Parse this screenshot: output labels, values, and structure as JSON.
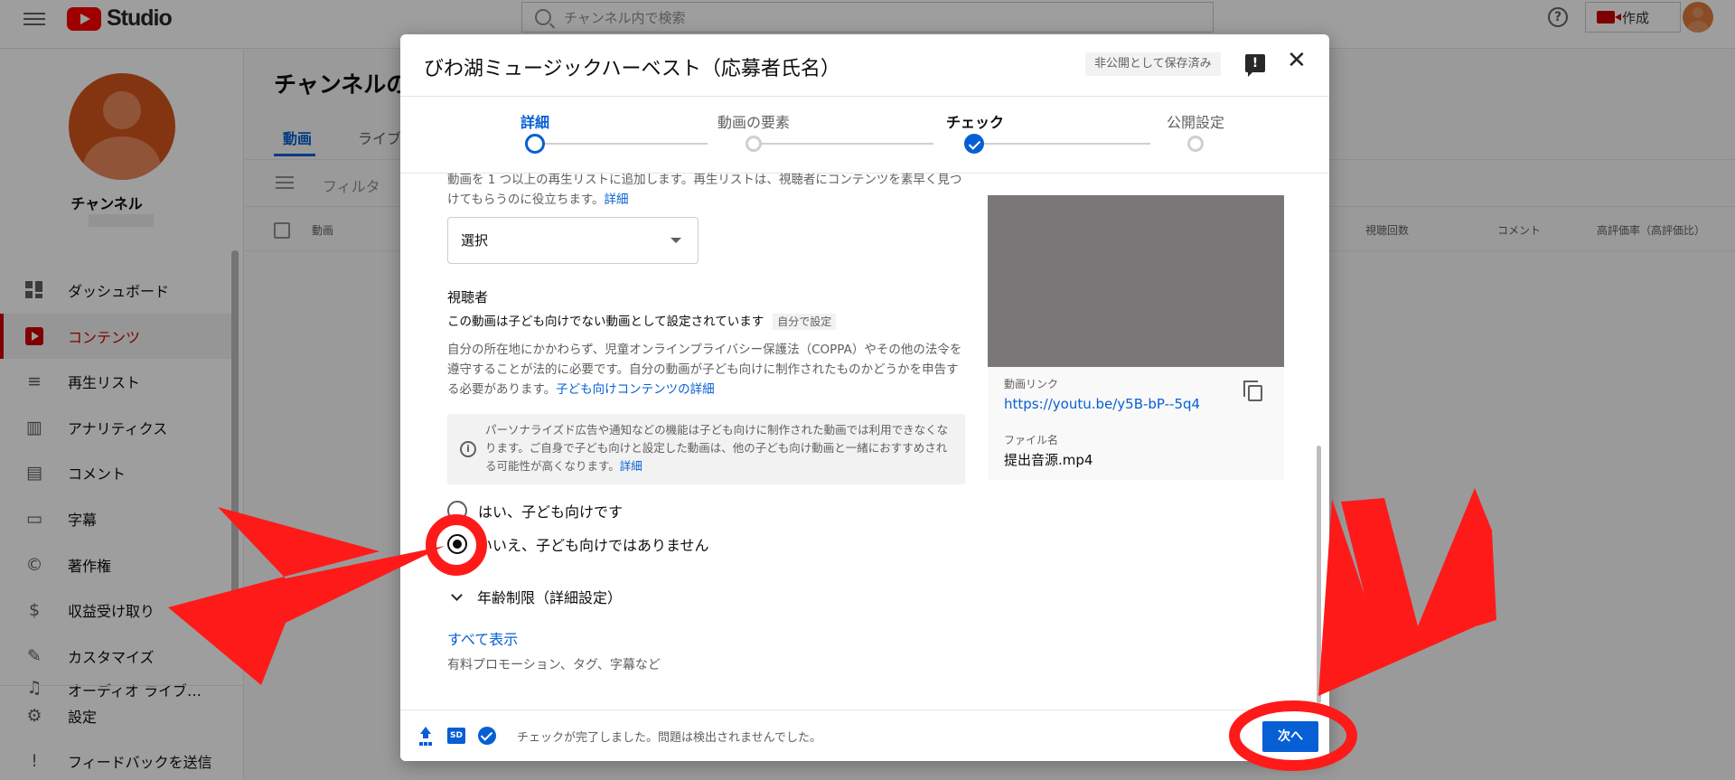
{
  "app": {
    "logo_text": "Studio",
    "search_placeholder": "チャンネル内で検索",
    "create_label": "作成",
    "help_glyph": "?"
  },
  "sidebar": {
    "channel_name": "チャンネル",
    "items": [
      {
        "label": "ダッシュボード",
        "icon": "dashboard-icon",
        "glyph": ""
      },
      {
        "label": "コンテンツ",
        "icon": "content-icon",
        "glyph": ""
      },
      {
        "label": "再生リスト",
        "icon": "playlist-icon",
        "glyph": "≡"
      },
      {
        "label": "アナリティクス",
        "icon": "analytics-icon",
        "glyph": "▥"
      },
      {
        "label": "コメント",
        "icon": "comment-icon",
        "glyph": "▤"
      },
      {
        "label": "字幕",
        "icon": "subtitles-icon",
        "glyph": "▭"
      },
      {
        "label": "著作権",
        "icon": "copyright-icon",
        "glyph": "©"
      },
      {
        "label": "収益受け取り",
        "icon": "dollar-icon",
        "glyph": "$"
      },
      {
        "label": "カスタマイズ",
        "icon": "magic-wand-icon",
        "glyph": "✎"
      },
      {
        "label": "オーディオ ライブ…",
        "icon": "audio-library-icon",
        "glyph": "♫"
      }
    ],
    "bottom_items": [
      {
        "label": "設定",
        "icon": "gear-icon",
        "glyph": "⚙"
      },
      {
        "label": "フィードバックを送信",
        "icon": "feedback-icon",
        "glyph": "!"
      }
    ]
  },
  "main": {
    "title": "チャンネルの",
    "tabs": [
      "動画",
      "ライブ"
    ],
    "filter_label": "フィルタ",
    "columns": [
      "動画",
      "視聴回数",
      "コメント",
      "高評価率（高評価比）"
    ]
  },
  "dialog": {
    "title": "びわ湖ミュージックハーベスト（応募者氏名）",
    "saved_badge": "非公開として保存済み",
    "close_glyph": "✕",
    "feedback_glyph": "!",
    "steps": [
      {
        "label": "詳細",
        "state": "current"
      },
      {
        "label": "動画の要素",
        "state": "pending"
      },
      {
        "label": "チェック",
        "state": "done"
      },
      {
        "label": "公開設定",
        "state": "pending"
      }
    ],
    "playlist": {
      "description": "動画を 1 つ以上の再生リストに追加します。再生リストは、視聴者にコンテンツを素早く見つけてもらうのに役立ちます。",
      "details_link": "詳細",
      "select_value": "選択"
    },
    "audience": {
      "title": "視聴者",
      "status": "この動画は子ども向けでない動画として設定されています",
      "status_tag": "自分で設定",
      "description": "自分の所在地にかかわらず、児童オンラインプライバシー保護法（COPPA）やその他の法令を遵守することが法的に必要です。自分の動画が子ども向けに制作されたものかどうかを申告する必要があります。",
      "description_link": "子ども向けコンテンツの詳細",
      "info": "パーソナライズド広告や通知などの機能は子ども向けに制作された動画では利用できなくなります。ご自身で子ども向けと設定した動画は、他の子ども向け動画と一緒におすすめされる可能性が高くなります。",
      "info_link": "詳細",
      "options": [
        {
          "label": "はい、子ども向けです",
          "checked": false
        },
        {
          "label": "いいえ、子ども向けではありません",
          "checked": true
        }
      ],
      "age_restriction": "年齢制限（詳細設定）"
    },
    "show_all": "すべて表示",
    "show_all_sub": "有料プロモーション、タグ、字幕など",
    "preview": {
      "link_label": "動画リンク",
      "link": "https://youtu.be/y5B-bP--5q4",
      "file_label": "ファイル名",
      "file_name": "提出音源.mp4"
    },
    "footer": {
      "sd_badge": "SD",
      "status_text": "チェックが完了しました。問題は検出されませんでした。",
      "next_label": "次へ"
    }
  },
  "annotation_colors": {
    "arrow": "#ff1a1a"
  }
}
